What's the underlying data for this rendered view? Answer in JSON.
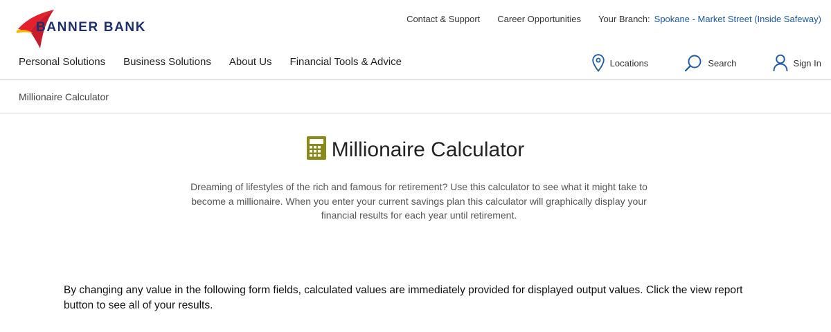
{
  "brand": {
    "name": "BANNER BANK",
    "colors": {
      "red": "#e3202b",
      "yellow": "#f7b500",
      "navy": "#1c2f6f",
      "link_blue": "#1a5aa6",
      "calculator_olive": "#8a8a1a"
    }
  },
  "utility_nav": {
    "contact": "Contact & Support",
    "careers": "Career Opportunities",
    "branch_label": "Your Branch:",
    "branch_name": "Spokane - Market Street (Inside Safeway)"
  },
  "main_nav": {
    "items": [
      {
        "label": "Personal Solutions"
      },
      {
        "label": "Business Solutions"
      },
      {
        "label": "About Us"
      },
      {
        "label": "Financial Tools & Advice"
      }
    ]
  },
  "actions": {
    "locations": {
      "label": "Locations",
      "icon": "map-pin-icon"
    },
    "search": {
      "label": "Search",
      "icon": "search-icon"
    },
    "signin": {
      "label": "Sign In",
      "icon": "user-icon"
    }
  },
  "breadcrumb": {
    "current": "Millionaire Calculator"
  },
  "main": {
    "icon": "calculator-icon",
    "title": "Millionaire Calculator",
    "intro": "Dreaming of lifestyles of the rich and famous for retirement? Use this calculator to see what it might take to become a millionaire. When you enter your current savings plan this calculator will graphically display your financial results for each year until retirement.",
    "instructions": "By changing any value in the following form fields, calculated values are immediately provided for displayed output values. Click the view report button to see all of your results."
  }
}
